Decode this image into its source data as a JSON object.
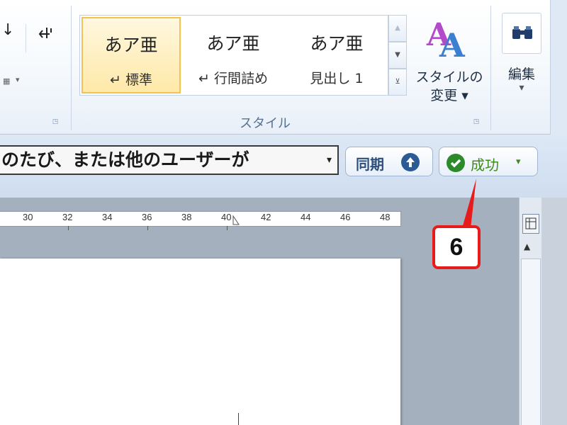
{
  "ribbon": {
    "paragraph_group": {
      "sort_arrow_icon": "down-arrow-icon",
      "show_marks_icon": "paragraph-mark-icon",
      "dropdown_glyph": "▾"
    },
    "styles_group": {
      "label": "スタイル",
      "items": [
        {
          "sample": "あア亜",
          "label": "↵ 標準",
          "selected": true
        },
        {
          "sample": "あア亜",
          "label": "↵ 行間詰め",
          "selected": false
        },
        {
          "sample": "あア亜",
          "label": "見出し 1",
          "selected": false
        }
      ],
      "change_styles_line1": "スタイルの",
      "change_styles_line2": "変更 ▾"
    },
    "editing_group": {
      "label": "編集",
      "dropdown": "▾",
      "icon": "binoculars-icon"
    }
  },
  "sync_bar": {
    "message": "のたび、または他のユーザーが",
    "message_dropdown": "▾",
    "sync_button_label": "同期",
    "status_label": "成功",
    "status_dropdown": "▾"
  },
  "ruler": {
    "ticks": [
      "30",
      "32",
      "34",
      "36",
      "38",
      "40",
      "42",
      "44",
      "46",
      "48"
    ]
  },
  "callout": {
    "number": "6"
  },
  "colors": {
    "accent": "#e81b1b",
    "success": "#3f8a1e",
    "selected_style": "#f2c255"
  }
}
